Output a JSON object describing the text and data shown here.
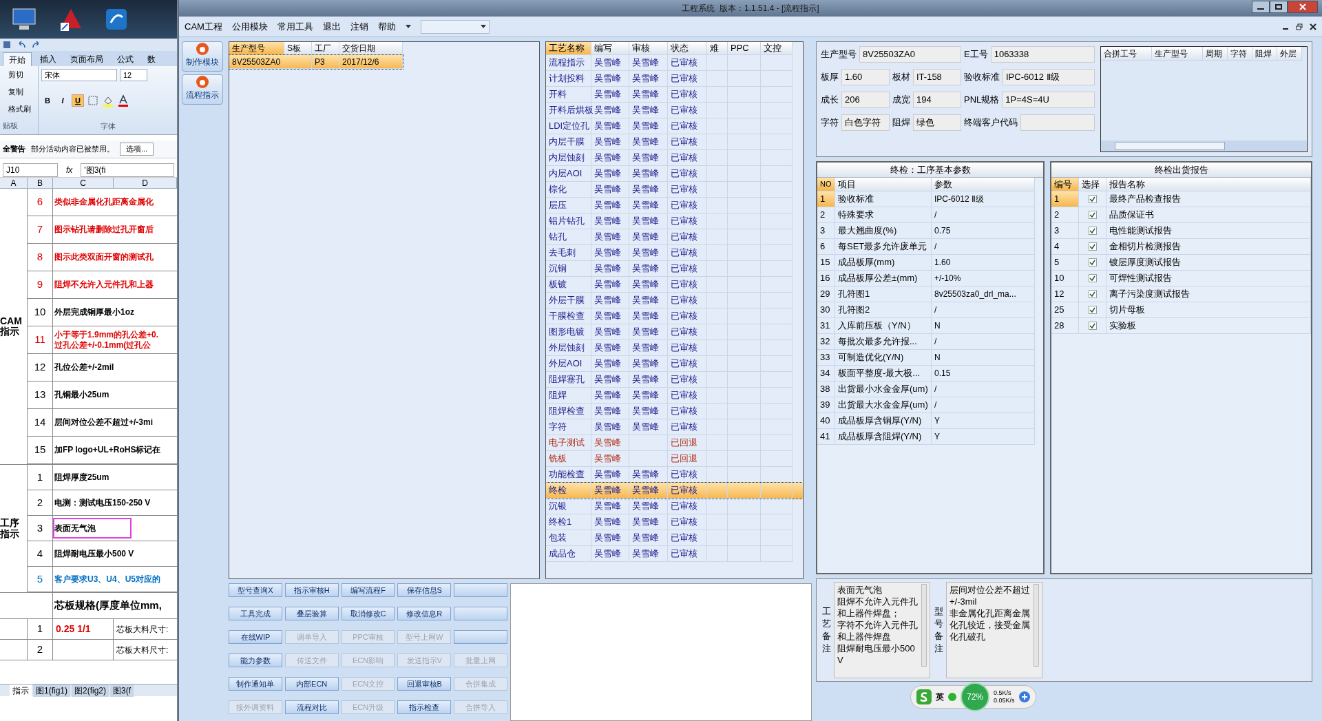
{
  "excel": {
    "ribbon_tabs": [
      {
        "label": "开始",
        "selected": true
      },
      {
        "label": "插入",
        "selected": false
      },
      {
        "label": "页面布局",
        "selected": false
      },
      {
        "label": "公式",
        "selected": false
      },
      {
        "label": "数",
        "selected": false
      }
    ],
    "clipboard": {
      "items": [
        "剪切",
        "复制",
        "格式刷"
      ],
      "group": "贴板"
    },
    "font": {
      "name": "宋体",
      "size": "12",
      "group": "字体",
      "format_buttons": [
        {
          "label": "B",
          "on": false
        },
        {
          "label": "I",
          "on": false
        },
        {
          "label": "U",
          "on": true
        }
      ]
    },
    "security_bar": {
      "title": "全警告",
      "message": "部分活动内容已被禁用。",
      "button": "选项..."
    },
    "formula_bar": {
      "cell": "J10",
      "fx": "fx",
      "content": "'图3(fi"
    },
    "columns": [
      "A",
      "B",
      "C",
      "D"
    ],
    "sections": [
      {
        "label": "CAM指示",
        "rows": [
          {
            "no": "6",
            "text": "类似非金属化孔距离金属化",
            "color": "#e00000",
            "highlighted": false
          },
          {
            "no": "7",
            "text": "图示钻孔请删除过孔开窗后",
            "color": "#e00000",
            "highlighted": false
          },
          {
            "no": "8",
            "text": "图示此类双面开窗的测试孔",
            "color": "#e00000",
            "highlighted": false
          },
          {
            "no": "9",
            "text": "阻焊不允许入元件孔和上器",
            "color": "#e00000",
            "highlighted": false
          },
          {
            "no": "10",
            "text": "外层完成铜厚最小1oz",
            "color": "#000000",
            "highlighted": false
          },
          {
            "no": "11",
            "text": "小于等于1.9mm的孔公差+0.\n过孔公差+/-0.1mm(过孔公",
            "color": "#e00000",
            "highlighted": false
          },
          {
            "no": "12",
            "text": "孔位公差+/-2mil",
            "color": "#000000",
            "highlighted": false
          },
          {
            "no": "13",
            "text": "孔铜最小25um",
            "color": "#000000",
            "highlighted": false
          },
          {
            "no": "14",
            "text": "层间对位公差不超过+/-3mi",
            "color": "#000000",
            "highlighted": false
          },
          {
            "no": "15",
            "text": "加FP logo+UL+RoHS标记在",
            "color": "#000000",
            "highlighted": false
          }
        ]
      },
      {
        "label": "工序指示",
        "rows": [
          {
            "no": "1",
            "text": "阻焊厚度25um",
            "color": "#000000",
            "highlighted": false
          },
          {
            "no": "2",
            "text": "电测：测试电压150-250 V",
            "color": "#000000",
            "highlighted": false
          },
          {
            "no": "3",
            "text": "表面无气泡",
            "color": "#000000",
            "highlighted": true
          },
          {
            "no": "4",
            "text": "阻焊耐电压最小500 V",
            "color": "#000000",
            "highlighted": false
          },
          {
            "no": "5",
            "text": "客户要求U3、U4、U5对应的",
            "color": "#0070c0",
            "highlighted": false
          }
        ]
      }
    ],
    "core_spec": {
      "title": "芯板规格(厚度单位mm,",
      "rows": [
        {
          "no": "1",
          "spec": "0.25 1/1",
          "size": "芯板大料尺寸:"
        },
        {
          "no": "2",
          "size": "芯板大料尺寸:"
        }
      ]
    },
    "sheet_tabs": [
      {
        "label": "指示",
        "selected": true
      },
      {
        "label": "图1(fig1)",
        "selected": false
      },
      {
        "label": "图2(fig2)",
        "selected": false
      },
      {
        "label": "图3(f",
        "selected": false
      }
    ]
  },
  "window": {
    "title": "工程系统  版本：1.1.51.4 - [流程指示]"
  },
  "menu": [
    "CAM工程",
    "公用模块",
    "常用工具",
    "退出",
    "注销",
    "帮助"
  ],
  "nav": [
    "制作模块",
    "流程指示"
  ],
  "orders": {
    "columns": [
      "生产型号",
      "S板",
      "工厂",
      "交货日期"
    ],
    "rows": [
      {
        "model": "8V25503ZA0",
        "factory": "P3",
        "date": "2017/12/6",
        "selected": true
      }
    ]
  },
  "process": {
    "columns": [
      "工艺名称",
      "编写",
      "审核",
      "状态",
      "难",
      "PPC",
      "文控"
    ],
    "rows": [
      {
        "name": "流程指示",
        "writer": "吴雪峰",
        "reviewer": "吴雪峰",
        "status": "已审核",
        "kind": "approved",
        "selected": false
      },
      {
        "name": "计划投料",
        "writer": "吴雪峰",
        "reviewer": "吴雪峰",
        "status": "已审核",
        "kind": "approved",
        "selected": false
      },
      {
        "name": "开料",
        "writer": "吴雪峰",
        "reviewer": "吴雪峰",
        "status": "已审核",
        "kind": "approved",
        "selected": false
      },
      {
        "name": "开料后烘板",
        "writer": "吴雪峰",
        "reviewer": "吴雪峰",
        "status": "已审核",
        "kind": "approved",
        "selected": false
      },
      {
        "name": "LDI定位孔",
        "writer": "吴雪峰",
        "reviewer": "吴雪峰",
        "status": "已审核",
        "kind": "approved",
        "selected": false
      },
      {
        "name": "内层干膜",
        "writer": "吴雪峰",
        "reviewer": "吴雪峰",
        "status": "已审核",
        "kind": "approved",
        "selected": false
      },
      {
        "name": "内层蚀刻",
        "writer": "吴雪峰",
        "reviewer": "吴雪峰",
        "status": "已审核",
        "kind": "approved",
        "selected": false
      },
      {
        "name": "内层AOI",
        "writer": "吴雪峰",
        "reviewer": "吴雪峰",
        "status": "已审核",
        "kind": "approved",
        "selected": false
      },
      {
        "name": "棕化",
        "writer": "吴雪峰",
        "reviewer": "吴雪峰",
        "status": "已审核",
        "kind": "approved",
        "selected": false
      },
      {
        "name": "层压",
        "writer": "吴雪峰",
        "reviewer": "吴雪峰",
        "status": "已审核",
        "kind": "approved",
        "selected": false
      },
      {
        "name": "铝片钻孔",
        "writer": "吴雪峰",
        "reviewer": "吴雪峰",
        "status": "已审核",
        "kind": "approved",
        "selected": false
      },
      {
        "name": "钻孔",
        "writer": "吴雪峰",
        "reviewer": "吴雪峰",
        "status": "已审核",
        "kind": "approved",
        "selected": false
      },
      {
        "name": "去毛刺",
        "writer": "吴雪峰",
        "reviewer": "吴雪峰",
        "status": "已审核",
        "kind": "approved",
        "selected": false
      },
      {
        "name": "沉铜",
        "writer": "吴雪峰",
        "reviewer": "吴雪峰",
        "status": "已审核",
        "kind": "approved",
        "selected": false
      },
      {
        "name": "板镀",
        "writer": "吴雪峰",
        "reviewer": "吴雪峰",
        "status": "已审核",
        "kind": "approved",
        "selected": false
      },
      {
        "name": "外层干膜",
        "writer": "吴雪峰",
        "reviewer": "吴雪峰",
        "status": "已审核",
        "kind": "approved",
        "selected": false
      },
      {
        "name": "干膜检查",
        "writer": "吴雪峰",
        "reviewer": "吴雪峰",
        "status": "已审核",
        "kind": "approved",
        "selected": false
      },
      {
        "name": "图形电镀",
        "writer": "吴雪峰",
        "reviewer": "吴雪峰",
        "status": "已审核",
        "kind": "approved",
        "selected": false
      },
      {
        "name": "外层蚀刻",
        "writer": "吴雪峰",
        "reviewer": "吴雪峰",
        "status": "已审核",
        "kind": "approved",
        "selected": false
      },
      {
        "name": "外层AOI",
        "writer": "吴雪峰",
        "reviewer": "吴雪峰",
        "status": "已审核",
        "kind": "approved",
        "selected": false
      },
      {
        "name": "阻焊塞孔",
        "writer": "吴雪峰",
        "reviewer": "吴雪峰",
        "status": "已审核",
        "kind": "approved",
        "selected": false
      },
      {
        "name": "阻焊",
        "writer": "吴雪峰",
        "reviewer": "吴雪峰",
        "status": "已审核",
        "kind": "approved",
        "selected": false
      },
      {
        "name": "阻焊检查",
        "writer": "吴雪峰",
        "reviewer": "吴雪峰",
        "status": "已审核",
        "kind": "approved",
        "selected": false
      },
      {
        "name": "字符",
        "writer": "吴雪峰",
        "reviewer": "吴雪峰",
        "status": "已审核",
        "kind": "approved",
        "selected": false
      },
      {
        "name": "电子测试",
        "writer": "吴雪峰",
        "status": "已回退",
        "kind": "returned",
        "selected": false
      },
      {
        "name": "铣板",
        "writer": "吴雪峰",
        "status": "已回退",
        "kind": "returned",
        "selected": false
      },
      {
        "name": "功能检查",
        "writer": "吴雪峰",
        "reviewer": "吴雪峰",
        "status": "已审核",
        "kind": "approved",
        "selected": false
      },
      {
        "name": "终检",
        "writer": "吴雪峰",
        "reviewer": "吴雪峰",
        "status": "已审核",
        "kind": "approved",
        "selected": true
      },
      {
        "name": "沉银",
        "writer": "吴雪峰",
        "reviewer": "吴雪峰",
        "status": "已审核",
        "kind": "approved",
        "selected": false
      },
      {
        "name": "终检1",
        "writer": "吴雪峰",
        "reviewer": "吴雪峰",
        "status": "已审核",
        "kind": "approved",
        "selected": false
      },
      {
        "name": "包装",
        "writer": "吴雪峰",
        "reviewer": "吴雪峰",
        "status": "已审核",
        "kind": "approved",
        "selected": false
      },
      {
        "name": "成品仓",
        "writer": "吴雪峰",
        "reviewer": "吴雪峰",
        "status": "已审核",
        "kind": "approved",
        "selected": false
      }
    ]
  },
  "info": {
    "header": {
      "model": {
        "label": "生产型号",
        "value": "8V25503ZA0"
      },
      "job": {
        "label": "E工号",
        "value": "1063338"
      }
    },
    "rows": [
      [
        {
          "label": "板厚",
          "value": "1.60"
        },
        {
          "label": "板材",
          "value": "IT-158"
        },
        {
          "label": "验收标准",
          "value": "IPC-6012 Ⅱ级"
        }
      ],
      [
        {
          "label": "成长",
          "value": "206"
        },
        {
          "label": "成宽",
          "value": "194"
        },
        {
          "label": "PNL规格",
          "value": "1P=4S=4U"
        }
      ],
      [
        {
          "label": "字符",
          "value": "白色字符"
        },
        {
          "label": "阻焊",
          "value": "绿色"
        },
        {
          "label": "终端客户代码"
        }
      ]
    ]
  },
  "merge_table": {
    "columns": [
      "合拼工号",
      "生产型号",
      "周期",
      "字符",
      "阻焊",
      "外层"
    ]
  },
  "params": {
    "title": "终检：工序基本参数",
    "columns": [
      "NO",
      "项目",
      "参数"
    ],
    "rows": [
      {
        "no": "1",
        "item": "验收标准",
        "value": "IPC-6012 Ⅱ级",
        "selected": true
      },
      {
        "no": "2",
        "item": "特殊要求",
        "value": "/",
        "selected": false
      },
      {
        "no": "3",
        "item": "最大翘曲度(%)",
        "value": "0.75",
        "selected": false
      },
      {
        "no": "6",
        "item": "每SET最多允许废单元",
        "value": "/",
        "selected": false
      },
      {
        "no": "15",
        "item": "成品板厚(mm)",
        "value": "1.60",
        "selected": false
      },
      {
        "no": "16",
        "item": "成品板厚公差±(mm)",
        "value": "+/-10%",
        "selected": false
      },
      {
        "no": "29",
        "item": "孔符图1",
        "value": "8v25503za0_drl_ma...",
        "selected": false
      },
      {
        "no": "30",
        "item": "孔符图2",
        "value": "/",
        "selected": false
      },
      {
        "no": "31",
        "item": "入库前压板（Y/N）",
        "value": "N",
        "selected": false
      },
      {
        "no": "32",
        "item": "每批次最多允许报...",
        "value": "/",
        "selected": false
      },
      {
        "no": "33",
        "item": "可制造优化(Y/N)",
        "value": "N",
        "selected": false
      },
      {
        "no": "34",
        "item": "板面平整度-最大极...",
        "value": "0.15",
        "selected": false
      },
      {
        "no": "38",
        "item": "出货最小水金金厚(um)",
        "value": "/",
        "selected": false
      },
      {
        "no": "39",
        "item": "出货最大水金金厚(um)",
        "value": "/",
        "selected": false
      },
      {
        "no": "40",
        "item": "成品板厚含铜厚(Y/N)",
        "value": "Y",
        "selected": false
      },
      {
        "no": "41",
        "item": "成品板厚含阻焊(Y/N)",
        "value": "Y",
        "selected": false
      }
    ]
  },
  "reports": {
    "title": "终检出货报告",
    "columns": [
      "编号",
      "选择",
      "报告名称"
    ],
    "rows": [
      {
        "no": "1",
        "checked": true,
        "name": "最终产品检查报告",
        "selected": true
      },
      {
        "no": "2",
        "checked": true,
        "name": "品质保证书",
        "selected": false
      },
      {
        "no": "3",
        "checked": true,
        "name": "电性能测试报告",
        "selected": false
      },
      {
        "no": "4",
        "checked": true,
        "name": "金相切片检测报告",
        "selected": false
      },
      {
        "no": "5",
        "checked": true,
        "name": "镀层厚度测试报告",
        "selected": false
      },
      {
        "no": "10",
        "checked": true,
        "name": "可焊性测试报告",
        "selected": false
      },
      {
        "no": "12",
        "checked": true,
        "name": "离子污染度测试报告",
        "selected": false
      },
      {
        "no": "25",
        "checked": true,
        "name": "切片母板",
        "selected": false
      },
      {
        "no": "28",
        "checked": true,
        "name": "实验板",
        "selected": false
      }
    ]
  },
  "buttons": [
    [
      {
        "kind": "button",
        "label": "型号查询X",
        "disabled": false
      },
      {
        "kind": "button",
        "label": "指示审核H",
        "disabled": false
      },
      {
        "kind": "button",
        "label": "编写流程F",
        "disabled": false
      },
      {
        "kind": "button",
        "label": "保存信息S",
        "disabled": false
      },
      {
        "kind": "blank"
      }
    ],
    [
      {
        "kind": "button",
        "label": "工具完成",
        "disabled": false
      },
      {
        "kind": "button",
        "label": "叠层验算",
        "disabled": false
      },
      {
        "kind": "button",
        "label": "取消修改C",
        "disabled": false
      },
      {
        "kind": "button",
        "label": "修改信息R",
        "disabled": false
      },
      {
        "kind": "blank"
      }
    ],
    [
      {
        "kind": "button",
        "label": "在线WIP",
        "disabled": false
      },
      {
        "kind": "button",
        "label": "调单导入",
        "disabled": true
      },
      {
        "kind": "button",
        "label": "PPC审核",
        "disabled": true
      },
      {
        "kind": "button",
        "label": "型号上网W",
        "disabled": true
      },
      {
        "kind": "blank"
      }
    ],
    [
      {
        "kind": "button",
        "label": "能力参数",
        "disabled": false
      },
      {
        "kind": "button",
        "label": "传送文件",
        "disabled": true
      },
      {
        "kind": "button",
        "label": "ECN影响",
        "disabled": true
      },
      {
        "kind": "button",
        "label": "发送指示V",
        "disabled": true
      },
      {
        "kind": "button",
        "label": "批量上网",
        "disabled": true
      }
    ],
    [
      {
        "kind": "button",
        "label": "制作通知单",
        "disabled": false
      },
      {
        "kind": "button",
        "label": "内部ECN",
        "disabled": false
      },
      {
        "kind": "button",
        "label": "ECN文控",
        "disabled": true
      },
      {
        "kind": "button",
        "label": "回退审核B",
        "disabled": false
      },
      {
        "kind": "button",
        "label": "合拼集成",
        "disabled": true
      }
    ],
    [
      {
        "kind": "button",
        "label": "接外调资料",
        "disabled": true
      },
      {
        "kind": "button",
        "label": "流程对比",
        "disabled": false
      },
      {
        "kind": "button",
        "label": "ECN升级",
        "disabled": true
      },
      {
        "kind": "button",
        "label": "指示检查",
        "disabled": false
      },
      {
        "kind": "button",
        "label": "合拼导入",
        "disabled": true
      }
    ]
  ],
  "notes": [
    {
      "label": "工艺备注",
      "lines": [
        "表面无气泡",
        "阻焊不允许入元件孔和上器件焊盘；",
        "字符不允许入元件孔和上器件焊盘",
        "阻焊耐电压最小500 V"
      ]
    },
    {
      "label": "型号备注",
      "lines": [
        "层间对位公差不超过+/-3mil",
        "非金属化孔距离金属化孔较近，接受金属化孔破孔"
      ]
    }
  ],
  "ime": {
    "lang": "英",
    "cpu": "72%",
    "up": "0.5K/s",
    "down": "0.05K/s"
  }
}
